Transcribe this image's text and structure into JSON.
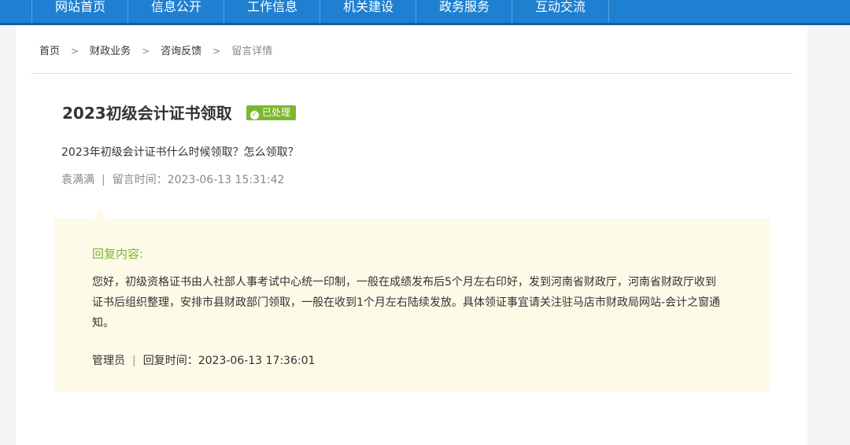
{
  "nav": {
    "items": [
      "网站首页",
      "信息公开",
      "工作信息",
      "机关建设",
      "政务服务",
      "互动交流"
    ]
  },
  "breadcrumb": {
    "home": "首页",
    "finance": "财政业务",
    "consult": "咨询反馈",
    "current": "留言详情",
    "separator": ">"
  },
  "message": {
    "title": "2023初级会计证书领取",
    "status": "已处理",
    "status_icon": "check-circle-icon",
    "question": "2023年初级会计证书什么时候领取？怎么领取？",
    "author": "袁满满",
    "time_label": "留言时间：",
    "time": "2023-06-13 15:31:42"
  },
  "reply": {
    "title": "回复内容:",
    "body": "您好，初级资格证书由人社部人事考试中心统一印制，一般在成绩发布后5个月左右印好，发到河南省财政厅，河南省财政厅收到证书后组织整理，安排市县财政部门领取，一般在收到1个月左右陆续发放。具体领证事宜请关注驻马店市财政局网站-会计之窗通知。",
    "responder": "管理员",
    "time_label": "回复时间：",
    "time": "2023-06-13 17:36:01"
  },
  "divider_char": "|",
  "colors": {
    "nav_bg": "#1f7fd0",
    "accent_green": "#7cb82f",
    "reply_bg": "#fdfae8"
  }
}
